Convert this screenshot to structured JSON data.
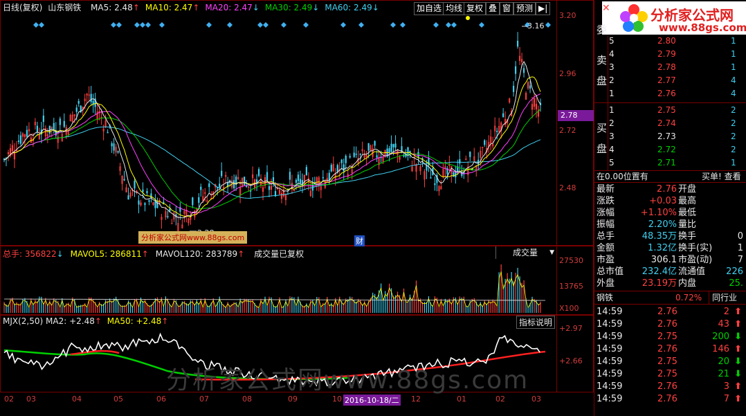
{
  "header": {
    "period": "日线(复权)",
    "stock": "山东钢铁",
    "ma": [
      {
        "label": "MA5: 2.48",
        "color": "#e8e8e8",
        "arrow": "↑"
      },
      {
        "label": "MA10: 2.47",
        "color": "#ffff00",
        "arrow": "↑"
      },
      {
        "label": "MA20: 2.47",
        "color": "#ff40ff",
        "arrow": "↓"
      },
      {
        "label": "MA30: 2.49",
        "color": "#00d000",
        "arrow": "↓"
      },
      {
        "label": "MA60: 2.49",
        "color": "#40d0f0",
        "arrow": "↓"
      }
    ],
    "buttons": [
      "加自选",
      "均线",
      "复权",
      "叠",
      "窗",
      "预测"
    ]
  },
  "price_axis": {
    "labels": [
      "3.20",
      "2.96",
      "2.72",
      "2.48"
    ],
    "current": "2.78"
  },
  "price_chart": {
    "high_mark": "3.16",
    "low_mark": "2.28",
    "event_label": "财",
    "watermark_label": "分析家公式网www.88gs.com"
  },
  "volume_panel": {
    "total": "总手: 356822",
    "mavol5": "MAVOL5: 286811",
    "mavol120": "MAVOL120: 283789",
    "note": "成交量已复权",
    "dropdown": "成交量",
    "axis": [
      "27530",
      "13765",
      "X100"
    ]
  },
  "indicator_panel": {
    "name": "MJX(2,50)",
    "ma2": "MA2: +2.48",
    "ma50": "MA50: +2.48",
    "explain_button": "指标说明",
    "axis": [
      "+2.97",
      "+2.66"
    ]
  },
  "time_axis": [
    "02",
    "03",
    "04",
    "05",
    "06",
    "07",
    "08",
    "09",
    "10",
    "2016-10-18/二",
    "12",
    "01",
    "02",
    "03"
  ],
  "watermark": "分析家公式网www.88gs.com",
  "sidebar": {
    "logo_title": "分析家公式网",
    "logo_url": "www.88gs.com",
    "weibi_label": "委",
    "sell_label": [
      "卖",
      "盘"
    ],
    "buy_label": [
      "买",
      "盘"
    ],
    "sell": [
      {
        "n": "5",
        "price": "2.80",
        "vol": "1"
      },
      {
        "n": "4",
        "price": "2.79",
        "vol": "1"
      },
      {
        "n": "3",
        "price": "2.78",
        "vol": "1"
      },
      {
        "n": "2",
        "price": "2.77",
        "vol": "4"
      },
      {
        "n": "1",
        "price": "2.76",
        "vol": "4"
      }
    ],
    "buy": [
      {
        "n": "1",
        "price": "2.75",
        "vol": "2"
      },
      {
        "n": "2",
        "price": "2.74",
        "vol": "2"
      },
      {
        "n": "3",
        "price": "2.73",
        "vol": "2"
      },
      {
        "n": "4",
        "price": "2.72",
        "vol": "2"
      },
      {
        "n": "5",
        "price": "2.71",
        "vol": "1"
      }
    ],
    "position_text": "在0.00位置有",
    "buy_link": "买单! 查看",
    "quote": [
      {
        "l": "最新",
        "v": "2.76",
        "r": "开盘"
      },
      {
        "l": "涨跌",
        "v": "+0.03",
        "r": "最高"
      },
      {
        "l": "涨幅",
        "v": "+1.10%",
        "r": "最低"
      },
      {
        "l": "振幅",
        "v": "2.20%",
        "r": "量比"
      },
      {
        "l": "总手",
        "v": "48.35万",
        "r": "换手",
        "rv": "0"
      },
      {
        "l": "金额",
        "v": "1.32亿",
        "r": "换手(实)",
        "rv": "1"
      },
      {
        "l": "市盈",
        "v": "306.1",
        "r": "市盈(动)",
        "rv": "7"
      },
      {
        "l": "总市值",
        "v": "232.4亿",
        "r": "流通值",
        "rv": "226"
      },
      {
        "l": "外盘",
        "v": "23.19万",
        "r": "内盘",
        "rv": "25."
      }
    ],
    "sector": {
      "name": "钢铁",
      "pct": "0.72%",
      "tab": "同行业"
    },
    "ticks": [
      {
        "t": "14:59",
        "p": "2.76",
        "v": "2",
        "d": "up"
      },
      {
        "t": "14:59",
        "p": "2.76",
        "v": "43",
        "d": "up"
      },
      {
        "t": "14:59",
        "p": "2.75",
        "v": "200",
        "d": "down"
      },
      {
        "t": "14:59",
        "p": "2.76",
        "v": "146",
        "d": "up"
      },
      {
        "t": "14:59",
        "p": "2.75",
        "v": "20",
        "d": "down"
      },
      {
        "t": "14:59",
        "p": "2.75",
        "v": "21",
        "d": "down"
      },
      {
        "t": "14:59",
        "p": "2.76",
        "v": "3",
        "d": "up"
      },
      {
        "t": "14:59",
        "p": "2.76",
        "v": "7",
        "d": "up"
      }
    ]
  }
}
